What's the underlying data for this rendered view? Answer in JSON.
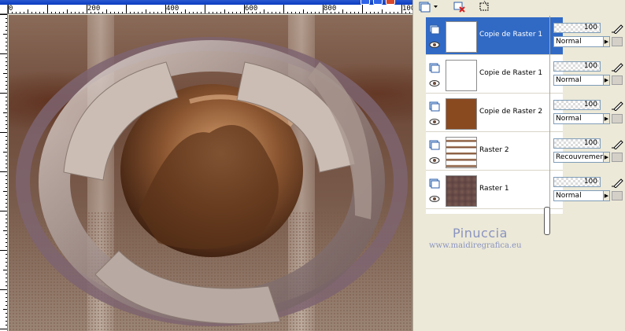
{
  "ruler": {
    "h_labels": [
      "0",
      "200",
      "400",
      "600",
      "800",
      "100"
    ]
  },
  "layers": [
    {
      "name": "Copie de Raster 1",
      "selected": true,
      "opacity": "100",
      "blend": "Normal"
    },
    {
      "name": "Copie de Raster 1",
      "selected": false,
      "opacity": "100",
      "blend": "Normal"
    },
    {
      "name": "Copie de Raster 2",
      "selected": false,
      "opacity": "100",
      "blend": "Normal"
    },
    {
      "name": "Raster 2",
      "selected": false,
      "opacity": "100",
      "blend": "Recouvrement"
    },
    {
      "name": "Raster 1",
      "selected": false,
      "opacity": "100",
      "blend": "Normal"
    }
  ],
  "watermark": {
    "title": "Pinuccia",
    "url": "www.maidiregrafica.eu"
  },
  "colors": {
    "selection": "#316ac5",
    "titlebar": "#0a3cc0",
    "watermark": "#8a94c0"
  },
  "icons": [
    "new-layer-icon",
    "dropdown-arrow-icon",
    "delete-layer-icon",
    "mask-icon",
    "visibility-eye-icon",
    "layer-type-icon",
    "edit-pen-icon",
    "lock-icon"
  ]
}
